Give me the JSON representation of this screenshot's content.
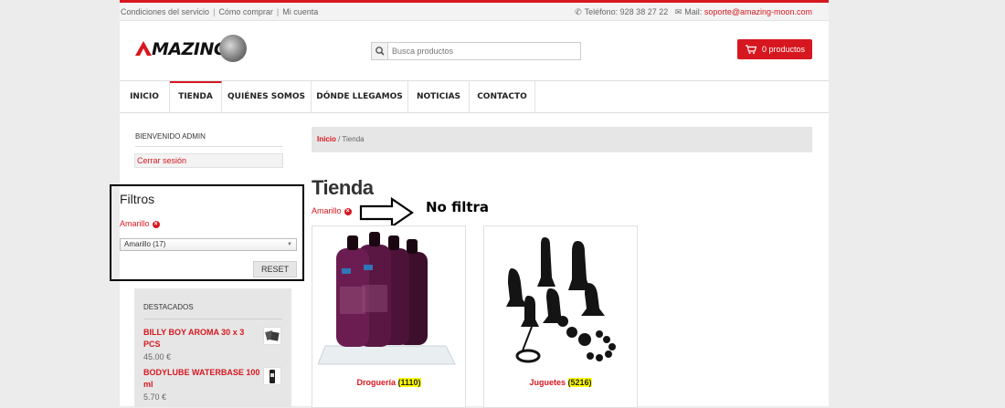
{
  "topbar": {
    "links": [
      "Condiciones del servicio",
      "Cómo comprar",
      "Mi cuenta"
    ],
    "phone": "Teléfono: 928 38 27 22",
    "mail_label": "Mail:",
    "mail": "soporte@amazing-moon.com"
  },
  "header": {
    "logo_text": "MAZING",
    "search_placeholder": "Busca productos",
    "cart_label": "0 productos"
  },
  "nav": {
    "items": [
      "INICIO",
      "TIENDA",
      "QUIÉNES SOMOS",
      "DÓNDE LLEGAMOS",
      "NOTICIAS",
      "CONTACTO"
    ],
    "active": "TIENDA"
  },
  "sidebar": {
    "welcome": "BIENVENIDO ADMIN",
    "logout": "Cerrar sesión",
    "filters_title": "Filtros",
    "active_filter": "Amarillo",
    "select_value": "Amarillo (17)",
    "reset": "RESET",
    "featured_title": "DESTACADOS",
    "featured": [
      {
        "name": "BILLY BOY AROMA 30 x 3 PCS",
        "price": "45.00 €"
      },
      {
        "name": "BODYLUBE WATERBASE 100 ml",
        "price": "5.70 €"
      }
    ]
  },
  "main": {
    "breadcrumb_home": "Inicio",
    "breadcrumb_sep": " / ",
    "breadcrumb_current": "Tienda",
    "title": "Tienda",
    "active_filter": "Amarillo",
    "annotation": "No filtra",
    "products": [
      {
        "name": "Droguería",
        "count": "(1110)"
      },
      {
        "name": "Juguetes",
        "count": "(5216)"
      }
    ]
  },
  "colors": {
    "accent": "#d7171f",
    "highlight": "#ffff00"
  }
}
